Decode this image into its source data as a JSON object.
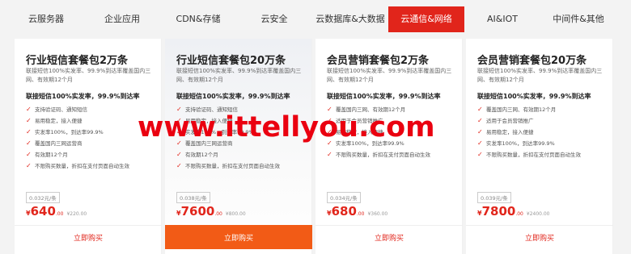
{
  "tabs": [
    {
      "label": "云服务器"
    },
    {
      "label": "企业应用"
    },
    {
      "label": "CDN&存储"
    },
    {
      "label": "云安全"
    },
    {
      "label": "云数据库&大数据"
    },
    {
      "label": "云通信&网络",
      "active": true
    },
    {
      "label": "AI&IOT"
    },
    {
      "label": "中间件&其他"
    }
  ],
  "cards": [
    {
      "title": "行业短信套餐包2万条",
      "desc": "联接短信100%实发率、99.9%到达率覆盖国内三网、有效期12个月",
      "subtitle": "联接短信100%实发率，99.9%到达率",
      "features": [
        "支持验证码、通知短信",
        "易用稳定，接入便捷",
        "实发率100%，到达率99.9%",
        "覆盖国内三网运营商",
        "有效期12个月",
        "不限购买数量，折扣在支付页面自动生效"
      ],
      "unit_price": "0.032元/条",
      "yen": "¥",
      "price_int": "640",
      "price_dec": ".00",
      "orig_price": "¥220.00",
      "buy_label": "立即购买"
    },
    {
      "title": "行业短信套餐包20万条",
      "desc": "联接短信100%实发率、99.9%到达率覆盖国内三网、有效期12个月",
      "subtitle": "联接短信100%实发率，99.9%到达率",
      "features": [
        "支持验证码、通知短信",
        "易用稳定，接入便捷",
        "实发率100%，到达率99.9%",
        "覆盖国内三网运营商",
        "有效期12个月",
        "不限购买数量，折扣在支付页面自动生效"
      ],
      "unit_price": "0.038元/条",
      "yen": "¥",
      "price_int": "7600",
      "price_dec": ".00",
      "orig_price": "¥800.00",
      "buy_label": "立即购买"
    },
    {
      "title": "会员营销套餐包2万条",
      "desc": "联接短信100%实发率、99.9%到达率覆盖国内三网、有效期12个月",
      "subtitle": "联接短信100%实发率，99.9%到达率",
      "features": [
        "覆盖国内三网、有效期12个月",
        "适用于会员营销推广",
        "易用稳定，接入便捷",
        "实发率100%，到达率99.9%",
        "不限购买数量，折扣在支付页面自动生效"
      ],
      "unit_price": "0.034元/条",
      "yen": "¥",
      "price_int": "680",
      "price_dec": ".00",
      "orig_price": "¥360.00",
      "buy_label": "立即购买"
    },
    {
      "title": "会员营销套餐包20万条",
      "desc": "联接短信100%实发率、99.9%到达率覆盖国内三网、有效期12个月",
      "subtitle": "联接短信100%实发率，99.9%到达率",
      "features": [
        "覆盖国内三网、有效期12个月",
        "适用于会员营销推广",
        "易用稳定，接入便捷",
        "实发率100%，到达率99.9%",
        "不限购买数量，折扣在支付页面自动生效"
      ],
      "unit_price": "0.039元/条",
      "yen": "¥",
      "price_int": "7800",
      "price_dec": ".00",
      "orig_price": "¥2400.00",
      "buy_label": "立即购买"
    }
  ],
  "watermark": "www.ittellyou.com",
  "colors": {
    "accent": "#e1251b",
    "active_buy": "#f25b16"
  }
}
